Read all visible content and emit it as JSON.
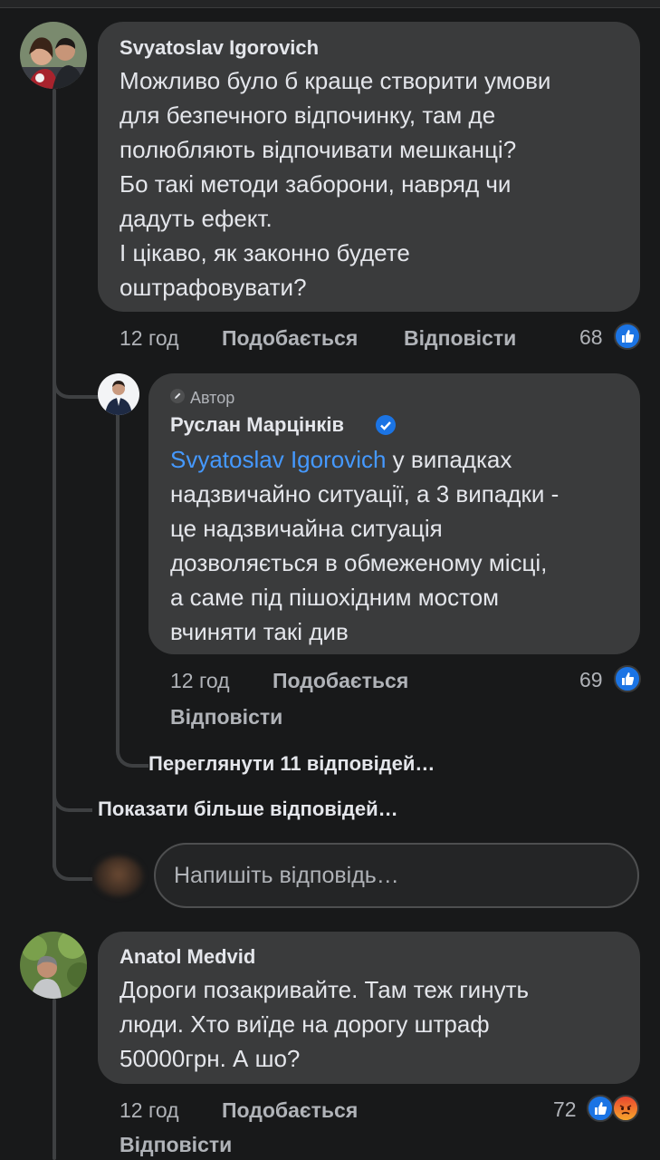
{
  "comments": [
    {
      "author": "Svyatoslav Igorovich",
      "text_lines": [
        "Можливо було б краще створити умови",
        "для безпечного відпочинку, там де",
        "полюбляють відпочивати мешканці?",
        "Бо такі методи заборони,  навряд чи",
        "дадуть ефект.",
        "І цікаво, як законно будете",
        "оштрафовувати?"
      ],
      "time": "12 год",
      "like_label": "Подобається",
      "reply_label": "Відповісти",
      "reaction_count": "68",
      "reactions": [
        "like-icon"
      ]
    },
    {
      "badge": "Автор",
      "author": "Руслан Марцінків",
      "verified": true,
      "mention": "Svyatoslav Igorovich",
      "text_first": " у випадках",
      "text_lines": [
        "надзвичайно ситуації, а 3 випадки -",
        "це надзвичайна ситуація",
        "дозволяється в обмеженому місці,",
        "а саме під пішохідним мостом",
        "вчиняти такі див"
      ],
      "time": "12 год",
      "like_label": "Подобається",
      "reply_label": "Відповісти",
      "reaction_count": "69",
      "reactions": [
        "like-icon"
      ]
    },
    {
      "author": "Anatol Medvid",
      "text_lines": [
        "Дороги позакривайте. Там теж гинуть",
        "люди. Хто виїде на дорогу штраф",
        "50000грн. А шо?"
      ],
      "time": "12 год",
      "like_label": "Подобається",
      "reply_label": "Відповісти",
      "reaction_count": "72",
      "reactions": [
        "like-icon",
        "angry-icon"
      ]
    }
  ],
  "view_replies": "Переглянути 11 відповідей…",
  "show_more": "Показати більше відповідей…",
  "reply_input": {
    "placeholder": "Напишіть відповідь…"
  },
  "colors": {
    "background": "#18191a",
    "bubble": "#3a3b3c",
    "mention": "#4599ff",
    "like": "#1b74e4"
  }
}
